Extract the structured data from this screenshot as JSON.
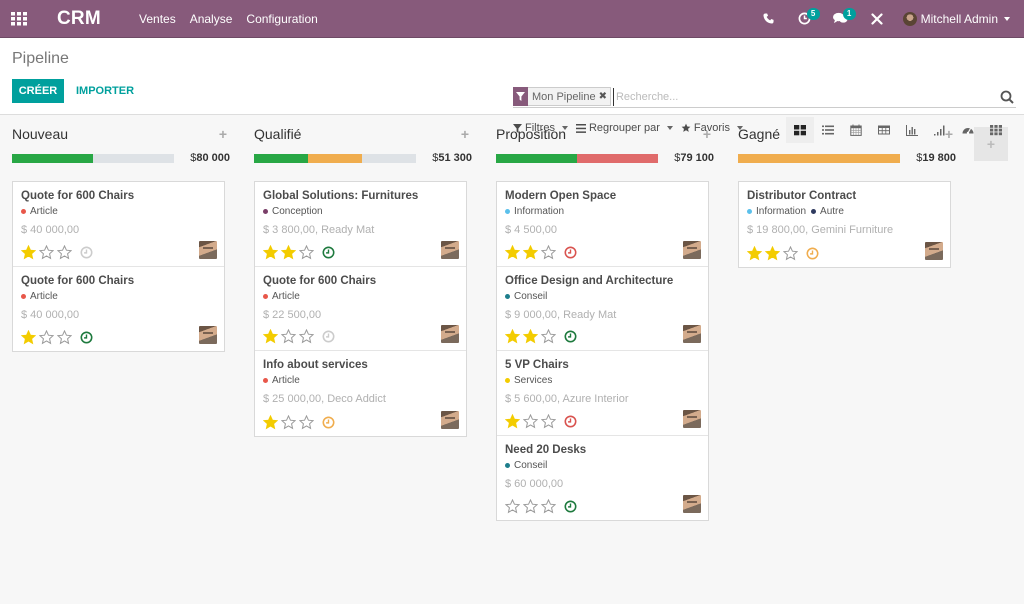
{
  "navbar": {
    "brand": "CRM",
    "menu": [
      "Ventes",
      "Analyse",
      "Configuration"
    ],
    "activity_badge": "5",
    "messages_badge": "1",
    "user_name": "Mitchell Admin"
  },
  "control_panel": {
    "title": "Pipeline",
    "create_label": "CRÉER",
    "import_label": "IMPORTER",
    "search": {
      "facet_label": "Mon Pipeline",
      "placeholder": "Recherche..."
    },
    "filters_label": "Filtres",
    "groupby_label": "Regrouper par",
    "favorites_label": "Favoris",
    "views": [
      "kanban",
      "list",
      "calendar",
      "pivot",
      "graph",
      "cohort",
      "dashboard",
      "grid"
    ],
    "active_view": "kanban"
  },
  "colors": {
    "brand": "#875A7B",
    "accent": "#00A09D",
    "progress_green": "#28A745",
    "progress_orange": "#F0AD4E",
    "progress_red": "#E06B6B",
    "activity_green": "#1E7A3E",
    "activity_red": "#D9534F",
    "activity_orange": "#F0AD4E",
    "activity_grey": "#cccccc",
    "star_gold": "#F3CC00"
  },
  "columns": [
    {
      "title": "Nouveau",
      "total": "80 000",
      "progress": [
        {
          "color": "green",
          "fraction": 0.5
        }
      ],
      "cards": [
        {
          "title": "Quote for 600 Chairs",
          "tags": [
            {
              "label": "Article",
              "color": "#E8574A"
            }
          ],
          "amount": "$ 40 000,00",
          "stars": 1,
          "activity": "grey"
        },
        {
          "title": "Quote for 600 Chairs",
          "tags": [
            {
              "label": "Article",
              "color": "#E8574A"
            }
          ],
          "amount": "$ 40 000,00",
          "stars": 1,
          "activity": "green"
        }
      ]
    },
    {
      "title": "Qualifié",
      "total": "51 300",
      "progress": [
        {
          "color": "green",
          "fraction": 0.333
        },
        {
          "color": "orange",
          "fraction": 0.333
        }
      ],
      "cards": [
        {
          "title": "Global Solutions: Furnitures",
          "tags": [
            {
              "label": "Conception",
              "color": "#7A3E68"
            }
          ],
          "amount": "$ 3 800,00, Ready Mat",
          "stars": 2,
          "activity": "green"
        },
        {
          "title": "Quote for 600 Chairs",
          "tags": [
            {
              "label": "Article",
              "color": "#E8574A"
            }
          ],
          "amount": "$ 22 500,00",
          "stars": 1,
          "activity": "grey"
        },
        {
          "title": "Info about services",
          "tags": [
            {
              "label": "Article",
              "color": "#E8574A"
            }
          ],
          "amount": "$ 25 000,00, Deco Addict",
          "stars": 1,
          "activity": "orange"
        }
      ]
    },
    {
      "title": "Proposition",
      "total": "79 100",
      "progress": [
        {
          "color": "green",
          "fraction": 0.5
        },
        {
          "color": "red",
          "fraction": 0.5
        }
      ],
      "cards": [
        {
          "title": "Modern Open Space",
          "tags": [
            {
              "label": "Information",
              "color": "#5BC0EB"
            }
          ],
          "amount": "$ 4 500,00",
          "stars": 2,
          "activity": "red"
        },
        {
          "title": "Office Design and Architecture",
          "tags": [
            {
              "label": "Conseil",
              "color": "#1E7E8C"
            }
          ],
          "amount": "$ 9 000,00, Ready Mat",
          "stars": 2,
          "activity": "green"
        },
        {
          "title": "5 VP Chairs",
          "tags": [
            {
              "label": "Services",
              "color": "#F3CC00"
            }
          ],
          "amount": "$ 5 600,00, Azure Interior",
          "stars": 1,
          "activity": "red"
        },
        {
          "title": "Need 20 Desks",
          "tags": [
            {
              "label": "Conseil",
              "color": "#1E7E8C"
            }
          ],
          "amount": "$ 60 000,00",
          "stars": 0,
          "activity": "green"
        }
      ]
    },
    {
      "title": "Gagné",
      "total": "19 800",
      "progress": [
        {
          "color": "orange",
          "fraction": 1.0
        }
      ],
      "cards": [
        {
          "title": "Distributor Contract",
          "tags": [
            {
              "label": "Information",
              "color": "#5BC0EB"
            },
            {
              "label": "Autre",
              "color": "#2F3A5F"
            }
          ],
          "amount": "$ 19 800,00, Gemini Furniture",
          "stars": 2,
          "activity": "orange"
        }
      ]
    }
  ],
  "currency_symbol": "$"
}
